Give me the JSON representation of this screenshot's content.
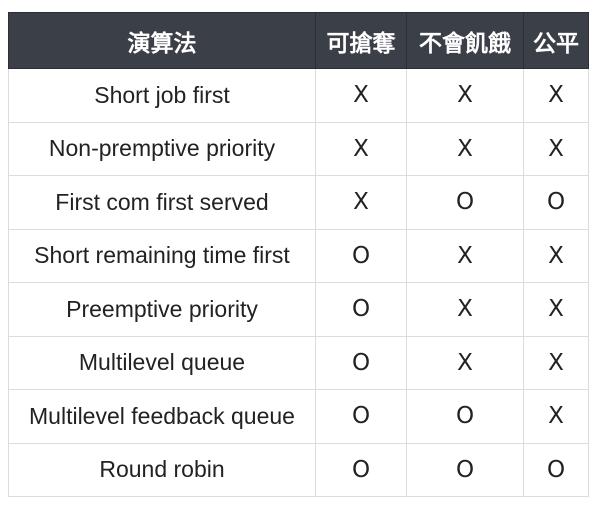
{
  "table": {
    "headers": [
      "演算法",
      "可搶奪",
      "不會飢餓",
      "公平"
    ],
    "rows": [
      [
        "Short job first",
        "X",
        "X",
        "X"
      ],
      [
        "Non-premptive priority",
        "X",
        "X",
        "X"
      ],
      [
        "First com first served",
        "X",
        "O",
        "O"
      ],
      [
        "Short remaining time first",
        "O",
        "X",
        "X"
      ],
      [
        "Preemptive priority",
        "O",
        "X",
        "X"
      ],
      [
        "Multilevel queue",
        "O",
        "X",
        "X"
      ],
      [
        "Multilevel feedback queue",
        "O",
        "O",
        "X"
      ],
      [
        "Round robin",
        "O",
        "O",
        "O"
      ]
    ]
  },
  "colors": {
    "header_bg": "#3b3f47",
    "header_text": "#ffffff",
    "border": "#dcdcdc",
    "text": "#222222"
  }
}
